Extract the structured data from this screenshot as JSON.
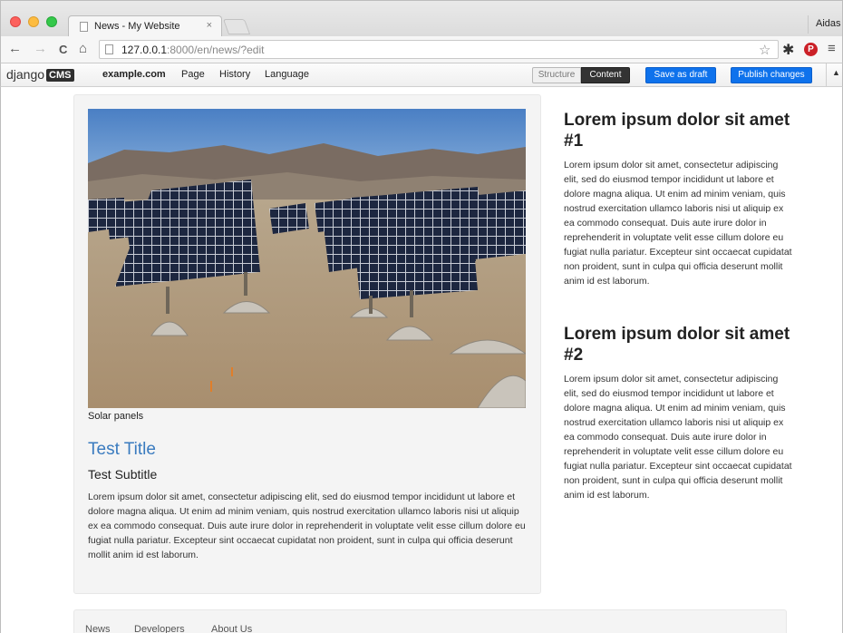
{
  "browser": {
    "tab_title": "News - My Website",
    "tab_close": "×",
    "profile_name": "Aidas",
    "url_host": "127.0.0.1",
    "url_rest": ":8000/en/news/?edit",
    "back_icon": "←",
    "forward_icon": "→",
    "reload_icon": "C",
    "home_icon": "⌂",
    "star_icon": "☆",
    "gear_icon": "✱",
    "pin_icon": "P",
    "menu_icon": "≡"
  },
  "cms_toolbar": {
    "logo_text": "django",
    "logo_badge": "CMS",
    "site": "example.com",
    "menu": [
      "Page",
      "History",
      "Language"
    ],
    "structure_label": "Structure",
    "content_label": "Content",
    "save_draft_label": "Save as draft",
    "publish_label": "Publish changes",
    "collapse_icon": "▲",
    "accent_color": "#0e72ec"
  },
  "article": {
    "image_caption": "Solar panels",
    "title": "Test Title",
    "subtitle": "Test Subtitle",
    "body": "Lorem ipsum dolor sit amet, consectetur adipiscing elit, sed do eiusmod tempor incididunt ut labore et dolore magna aliqua. Ut enim ad minim veniam, quis nostrud exercitation ullamco laboris nisi ut aliquip ex ea commodo consequat. Duis aute irure dolor in reprehenderit in voluptate velit esse cillum dolore eu fugiat nulla pariatur. Excepteur sint occaecat cupidatat non proident, sunt in culpa qui officia deserunt mollit anim id est laborum.",
    "title_color": "#3a7bbf"
  },
  "sidebar": {
    "posts": [
      {
        "title": "Lorem ipsum dolor sit amet #1",
        "body": "Lorem ipsum dolor sit amet, consectetur adipiscing elit, sed do eiusmod tempor incididunt ut labore et dolore magna aliqua. Ut enim ad minim veniam, quis nostrud exercitation ullamco laboris nisi ut aliquip ex ea commodo consequat. Duis aute irure dolor in reprehenderit in voluptate velit esse cillum dolore eu fugiat nulla pariatur. Excepteur sint occaecat cupidatat non proident, sunt in culpa qui officia deserunt mollit anim id est laborum."
      },
      {
        "title": "Lorem ipsum dolor sit amet #2",
        "body": "Lorem ipsum dolor sit amet, consectetur adipiscing elit, sed do eiusmod tempor incididunt ut labore et dolore magna aliqua. Ut enim ad minim veniam, quis nostrud exercitation ullamco laboris nisi ut aliquip ex ea commodo consequat. Duis aute irure dolor in reprehenderit in voluptate velit esse cillum dolore eu fugiat nulla pariatur. Excepteur sint occaecat cupidatat non proident, sunt in culpa qui officia deserunt mollit anim id est laborum."
      }
    ]
  },
  "footer": {
    "links": [
      "News",
      "Developers",
      "About Us"
    ]
  }
}
